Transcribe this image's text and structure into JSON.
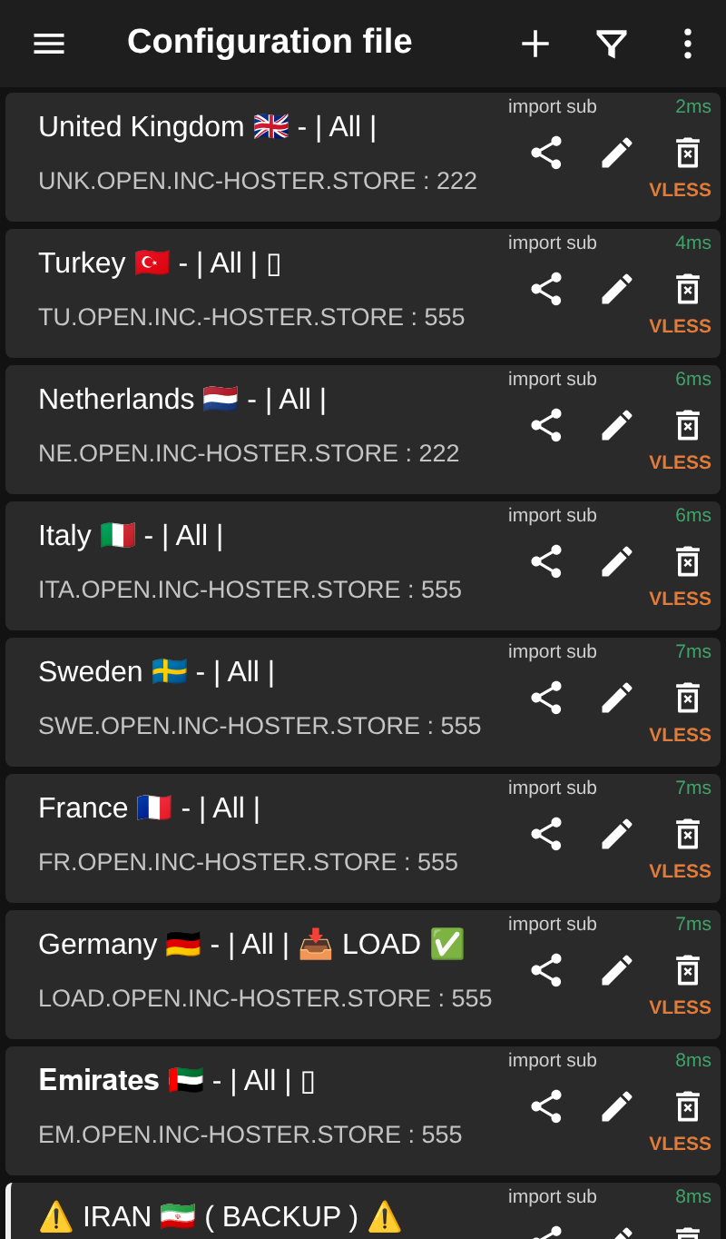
{
  "toolbar": {
    "title": "Configuration file"
  },
  "servers": [
    {
      "name": "United Kingdom 🇬🇧 - | All |",
      "address": "UNK.OPEN.INC-HOSTER.STORE : 222",
      "subscription": "import sub",
      "latency": "2ms",
      "protocol": "VLESS",
      "selected": false
    },
    {
      "name": "Turkey 🇹🇷 - | All | ▯",
      "address": "TU.OPEN.INC.-HOSTER.STORE : 555",
      "subscription": "import sub",
      "latency": "4ms",
      "protocol": "VLESS",
      "selected": false
    },
    {
      "name": "Netherlands 🇳🇱 - | All |",
      "address": "NE.OPEN.INC-HOSTER.STORE : 222",
      "subscription": "import sub",
      "latency": "6ms",
      "protocol": "VLESS",
      "selected": false
    },
    {
      "name": "Italy 🇮🇹 - | All |",
      "address": "ITA.OPEN.INC-HOSTER.STORE : 555",
      "subscription": "import sub",
      "latency": "6ms",
      "protocol": "VLESS",
      "selected": false
    },
    {
      "name": "Sweden 🇸🇪 - | All |",
      "address": "SWE.OPEN.INC-HOSTER.STORE : 555",
      "subscription": "import sub",
      "latency": "7ms",
      "protocol": "VLESS",
      "selected": false
    },
    {
      "name": "France 🇫🇷 - | All |",
      "address": "FR.OPEN.INC-HOSTER.STORE : 555",
      "subscription": "import sub",
      "latency": "7ms",
      "protocol": "VLESS",
      "selected": false
    },
    {
      "name": "Germany 🇩🇪 - | All | 📥 LOAD ✅",
      "address": "LOAD.OPEN.INC-HOSTER.STORE : 555",
      "subscription": "import sub",
      "latency": "7ms",
      "protocol": "VLESS",
      "selected": false
    },
    {
      "name": "𝐄𝐦𝐢𝐫𝐚𝐭𝐞𝐬 🇦🇪 - | All | ▯",
      "address": "EM.OPEN.INC-HOSTER.STORE : 555",
      "subscription": "import sub",
      "latency": "8ms",
      "protocol": "VLESS",
      "selected": false
    },
    {
      "name": "⚠️ IRAN 🇮🇷 ( BACKUP ) ⚠️",
      "subscription": "import sub",
      "latency": "8ms",
      "selected": true
    }
  ]
}
